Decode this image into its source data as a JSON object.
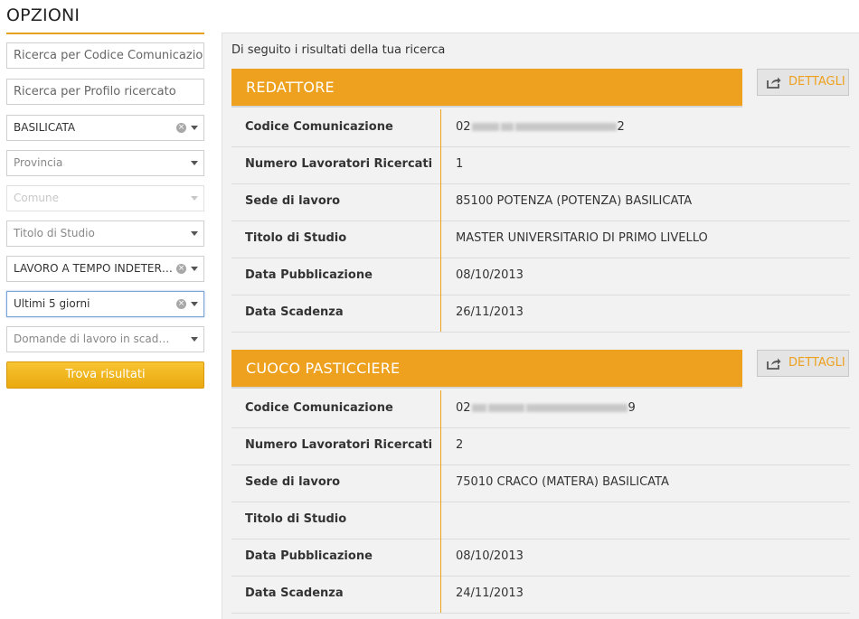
{
  "sidebar": {
    "title": "OPZIONI",
    "search_code_placeholder": "Ricerca per Codice Comunicazione",
    "search_profile_placeholder": "Ricerca per Profilo ricercato",
    "regione": "BASILICATA",
    "provincia": "Provincia",
    "comune": "Comune",
    "titolo_studio": "Titolo di Studio",
    "tipo_contratto": "LAVORO A TEMPO INDETERMINATO",
    "periodo": "Ultimi 5 giorni",
    "scadenza": "Domande di lavoro in scadenza",
    "search_button": "Trova risultati",
    "clear_symbol": "×"
  },
  "main": {
    "intro": "Di seguito i risultati della tua ricerca",
    "details_label": "DETTAGLI",
    "results": [
      {
        "title": "REDATTORE",
        "labels": {
          "codice": "Codice Comunicazione",
          "numero": "Numero Lavoratori Ricercati",
          "sede": "Sede di lavoro",
          "titolo": "Titolo di Studio",
          "pubblicazione": "Data Pubblicazione",
          "scadenza": "Data Scadenza"
        },
        "codice_prefix": "02",
        "codice_suffix": "2",
        "numero": "1",
        "sede": "85100 POTENZA (POTENZA) BASILICATA",
        "titolo": "MASTER UNIVERSITARIO DI PRIMO LIVELLO",
        "pubblicazione": "08/10/2013",
        "scadenza": "26/11/2013"
      },
      {
        "title": "CUOCO PASTICCIERE",
        "labels": {
          "codice": "Codice Comunicazione",
          "numero": "Numero Lavoratori Ricercati",
          "sede": "Sede di lavoro",
          "titolo": "Titolo di Studio",
          "pubblicazione": "Data Pubblicazione",
          "scadenza": "Data Scadenza"
        },
        "codice_prefix": "02",
        "codice_suffix": "9",
        "numero": "2",
        "sede": "75010 CRACO (MATERA) BASILICATA",
        "titolo": "",
        "pubblicazione": "08/10/2013",
        "scadenza": "24/11/2013"
      }
    ]
  },
  "colors": {
    "accent": "#eda11e",
    "button_top": "#f7c531",
    "button_bottom": "#eaa90f",
    "panel_bg": "#f2f2f2"
  },
  "icons": {
    "share": "share-icon",
    "clear": "clear-icon",
    "dropdown": "chevron-down-icon"
  }
}
